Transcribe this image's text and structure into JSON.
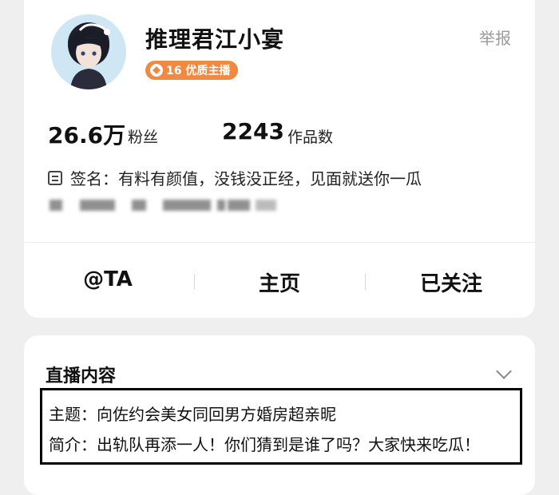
{
  "profile": {
    "name": "推理君江小宴",
    "report_label": "举报",
    "badge_label": "16 优质主播",
    "stats": {
      "followers_value": "26.6万",
      "followers_label": "粉丝",
      "works_value": "2243",
      "works_label": "作品数"
    },
    "signature_prefix": "签名：",
    "signature_text": "有料有颜值，没钱没正经，见面就送你一瓜"
  },
  "actions": {
    "at_label": "@TA",
    "home_label": "主页",
    "follow_label": "已关注"
  },
  "live": {
    "section_title": "直播内容",
    "topic_prefix": "主题：",
    "topic_text": "向佐约会美女同回男方婚房超亲昵",
    "intro_prefix": "简介：",
    "intro_text": "出轨队再添一人！你们猜到是谁了吗？大家快来吃瓜！"
  },
  "colors": {
    "badge": "#f08a42",
    "report": "#9a9a9a",
    "background": "#efefef"
  },
  "icons": [
    "avatar",
    "badge-diamond-icon",
    "signature-icon",
    "chevron-down-icon"
  ]
}
